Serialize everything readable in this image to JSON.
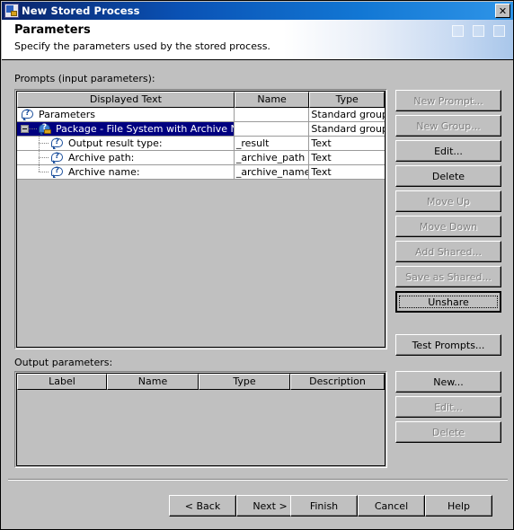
{
  "window": {
    "title": "New Stored Process",
    "title_icon": "stored-process-icon",
    "close_label": "✕"
  },
  "header": {
    "title": "Parameters",
    "subtitle": "Specify the parameters used by the stored process.",
    "decor_squares": 3
  },
  "prompts_section": {
    "label": "Prompts (input parameters):",
    "columns": [
      "Displayed Text",
      "Name",
      "Type"
    ],
    "rows": [
      {
        "displayed_text": "Parameters",
        "name": "",
        "type": "Standard group",
        "level": 0,
        "icon": "prompt-bubble-icon",
        "expander": "none",
        "shared": false,
        "selected": false
      },
      {
        "displayed_text": "Package - File System with Archive Name",
        "name": "",
        "type": "Standard group",
        "level": 1,
        "icon": "shared-prompt-bubble-icon",
        "expander": "expanded",
        "shared": true,
        "selected": true
      },
      {
        "displayed_text": "Output result type:",
        "name": "_result",
        "type": "Text",
        "level": 2,
        "icon": "prompt-bubble-icon",
        "expander": "none",
        "shared": false,
        "selected": false
      },
      {
        "displayed_text": "Archive path:",
        "name": "_archive_path",
        "type": "Text",
        "level": 2,
        "icon": "prompt-bubble-icon",
        "expander": "none",
        "shared": false,
        "selected": false
      },
      {
        "displayed_text": "Archive name:",
        "name": "_archive_name",
        "type": "Text",
        "level": 2,
        "icon": "prompt-bubble-icon",
        "expander": "none",
        "shared": false,
        "selected": false
      }
    ],
    "buttons": [
      {
        "label": "New Prompt...",
        "enabled": false,
        "focused": false
      },
      {
        "label": "New Group...",
        "enabled": false,
        "focused": false
      },
      {
        "label": "Edit...",
        "enabled": true,
        "focused": false
      },
      {
        "label": "Delete",
        "enabled": true,
        "focused": false
      },
      {
        "label": "Move Up",
        "enabled": false,
        "focused": false
      },
      {
        "label": "Move Down",
        "enabled": false,
        "focused": false
      },
      {
        "label": "Add Shared...",
        "enabled": false,
        "focused": false
      },
      {
        "label": "Save as Shared...",
        "enabled": false,
        "focused": false
      },
      {
        "label": "Unshare",
        "enabled": true,
        "focused": true
      },
      {
        "label": "Test Prompts...",
        "enabled": true,
        "focused": false
      }
    ]
  },
  "output_section": {
    "label": "Output parameters:",
    "columns": [
      "Label",
      "Name",
      "Type",
      "Description"
    ],
    "rows": [],
    "buttons": [
      {
        "label": "New...",
        "enabled": true
      },
      {
        "label": "Edit...",
        "enabled": false
      },
      {
        "label": "Delete",
        "enabled": false
      }
    ]
  },
  "footer": {
    "buttons": [
      {
        "label": "< Back",
        "enabled": true
      },
      {
        "label": "Next >",
        "enabled": true
      },
      {
        "label": "Finish",
        "enabled": true
      },
      {
        "label": "Cancel",
        "enabled": true
      },
      {
        "label": "Help",
        "enabled": true
      }
    ]
  },
  "colors": {
    "face": "#c0c0c0",
    "selection": "#000080",
    "title_start": "#0a246a",
    "title_end": "#2f95e8",
    "text": "#000000",
    "disabled_text": "#808080"
  }
}
